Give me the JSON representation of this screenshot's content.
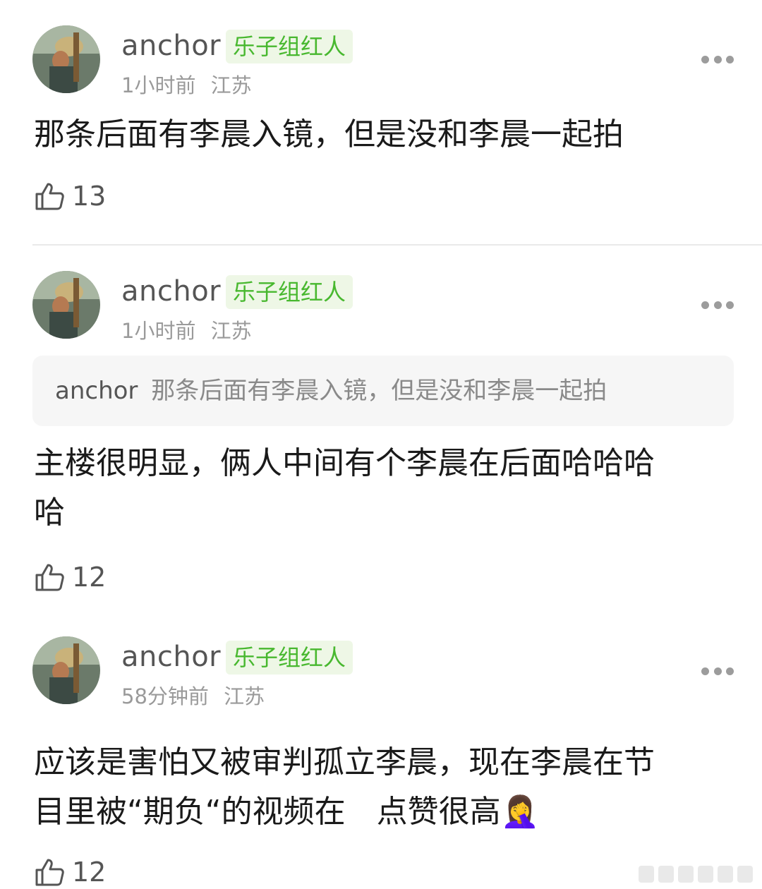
{
  "comments": [
    {
      "username": "anchor",
      "badge": "乐子组红人",
      "time": "1小时前",
      "location": "江苏",
      "text_lines": [
        "那条后面有李晨入镜，但是没和李晨一起拍"
      ],
      "likes": "13"
    },
    {
      "username": "anchor",
      "badge": "乐子组红人",
      "time": "1小时前",
      "location": "江苏",
      "quote": {
        "user": "anchor",
        "text": "那条后面有李晨入镜，但是没和李晨一起拍"
      },
      "text_lines": [
        "主楼很明显，俩人中间有个李晨在后面哈哈哈",
        "哈"
      ],
      "likes": "12"
    },
    {
      "username": "anchor",
      "badge": "乐子组红人",
      "time": "58分钟前",
      "location": "江苏",
      "text_lines": [
        "应该是害怕又被审判孤立李晨，现在李晨在节",
        "目里被“期负“的视频在　点赞很高🤦‍♀️"
      ],
      "likes": "12"
    }
  ],
  "icons": {
    "like": "thumbs-up-icon",
    "more": "more-options-icon"
  },
  "colors": {
    "badge_bg": "#eef7e6",
    "badge_text": "#48b82f",
    "meta_text": "#9a9a9a"
  }
}
